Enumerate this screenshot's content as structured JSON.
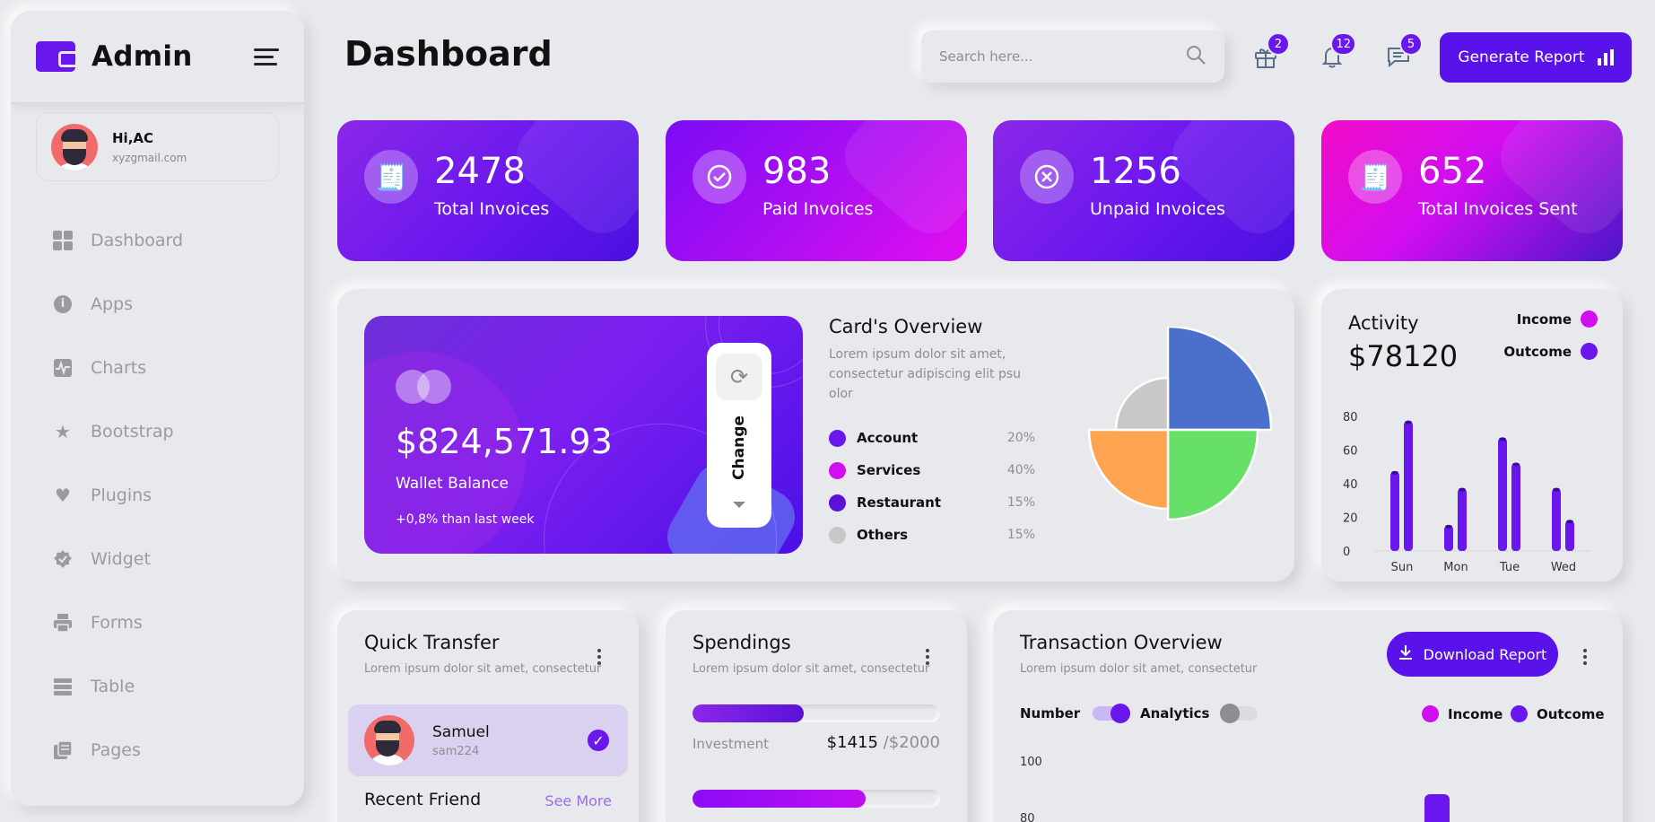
{
  "app": {
    "title": "Admin"
  },
  "user": {
    "greeting": "Hi,AC",
    "email": "xyzgmail.com"
  },
  "sidebar": {
    "items": [
      {
        "label": "Dashboard",
        "icon": "dashboard-icon"
      },
      {
        "label": "Apps",
        "icon": "info-icon"
      },
      {
        "label": "Charts",
        "icon": "chart-pulse-icon"
      },
      {
        "label": "Bootstrap",
        "icon": "star-icon"
      },
      {
        "label": "Plugins",
        "icon": "heart-icon"
      },
      {
        "label": "Widget",
        "icon": "badge-check-icon"
      },
      {
        "label": "Forms",
        "icon": "printer-icon"
      },
      {
        "label": "Table",
        "icon": "table-icon"
      },
      {
        "label": "Pages",
        "icon": "pages-icon"
      }
    ]
  },
  "header": {
    "title": "Dashboard",
    "search_placeholder": "Search here...",
    "notifications": {
      "gift": "2",
      "bell": "12",
      "messages": "5"
    },
    "generate_label": "Generate Report"
  },
  "stats": [
    {
      "value": "2478",
      "label": "Total Invoices",
      "icon": "receipt-icon"
    },
    {
      "value": "983",
      "label": "Paid Invoices",
      "icon": "check-circle-icon"
    },
    {
      "value": "1256",
      "label": "Unpaid Invoices",
      "icon": "x-circle-icon"
    },
    {
      "value": "652",
      "label": "Total Invoices Sent",
      "icon": "receipt-icon"
    }
  ],
  "wallet": {
    "amount": "$824,571.93",
    "label": "Wallet Balance",
    "change": "+0,8% than last week",
    "change_button": "Change"
  },
  "overview": {
    "title": "Card's Overview",
    "description": "Lorem ipsum dolor sit amet, consectetur adipiscing elit psu olor",
    "legend": [
      {
        "name": "Account",
        "pct": "20%",
        "color": "#6a17ee"
      },
      {
        "name": "Services",
        "pct": "40%",
        "color": "#d10ef0"
      },
      {
        "name": "Restaurant",
        "pct": "15%",
        "color": "#5a12d8"
      },
      {
        "name": "Others",
        "pct": "15%",
        "color": "#c8c8c8"
      }
    ]
  },
  "activity": {
    "title": "Activity",
    "value": "$78120",
    "legend": {
      "income": "Income",
      "outcome": "Outcome"
    },
    "colors": {
      "income": "#d10ef0",
      "outcome": "#6a17ee",
      "bars": "#6a17ee"
    }
  },
  "chart_data": [
    {
      "type": "pie",
      "title": "",
      "slices": [
        {
          "value": 35,
          "color": "#4a70cc"
        },
        {
          "value": 25,
          "color": "#66e066"
        },
        {
          "value": 25,
          "color": "#ffa552"
        },
        {
          "value": 15,
          "color": "#c8c8c8"
        }
      ]
    },
    {
      "type": "bar",
      "title": "",
      "categories": [
        "Sun",
        "Mon",
        "Tue",
        "Wed"
      ],
      "series": [
        {
          "values": [
            47,
            15,
            67,
            37
          ]
        },
        {
          "values": [
            77,
            37,
            52,
            18
          ]
        }
      ],
      "yticks": [
        "0",
        "20",
        "40",
        "60",
        "80"
      ],
      "ylim": [
        0,
        80
      ]
    }
  ],
  "quick_transfer": {
    "title": "Quick Transfer",
    "subtitle": "Lorem ipsum dolor sit amet, consectetur",
    "friend": {
      "name": "Samuel",
      "username": "sam224"
    },
    "recent_title": "Recent Friend",
    "see_more": "See More"
  },
  "spendings": {
    "title": "Spendings",
    "subtitle": "Lorem ipsum dolor sit amet, consectetur",
    "items": [
      {
        "label": "Investment",
        "amount": "$1415",
        "total": "/$2000",
        "fraction": 0.45,
        "color": "#6a17ee"
      },
      {
        "label": "",
        "amount": "",
        "total": "",
        "fraction": 0.7,
        "color": "#b60ef2"
      }
    ]
  },
  "transactions": {
    "title": "Transaction Overview",
    "subtitle": "Lorem ipsum dolor sit amet, consectetur",
    "download_label": "Download Report",
    "toggles": {
      "number": "Number",
      "analytics": "Analytics"
    },
    "legend": {
      "income": "Income",
      "outcome": "Outcome"
    },
    "yticks": [
      "100",
      "80"
    ]
  }
}
